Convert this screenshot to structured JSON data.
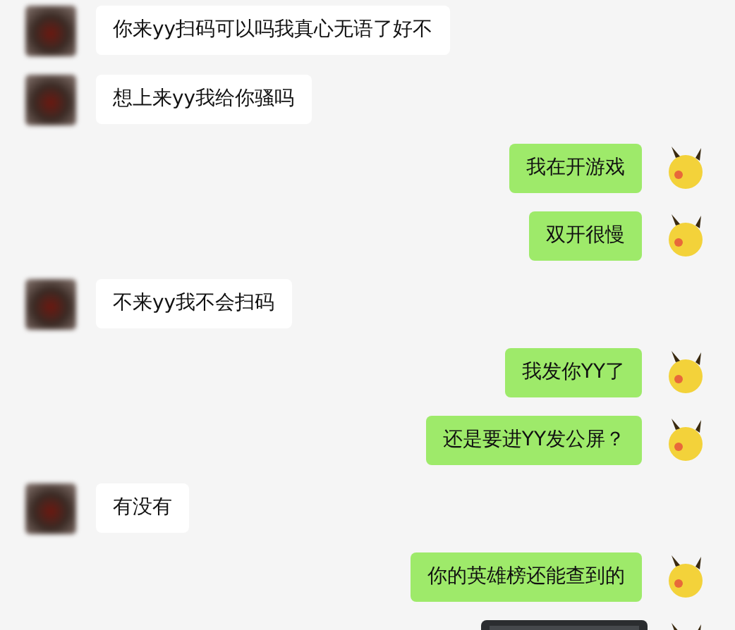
{
  "messages": [
    {
      "kind": "received",
      "text": "你来yy扫码可以吗我真心无语了好不"
    },
    {
      "kind": "received",
      "text": "想上来yy我给你骚吗"
    },
    {
      "kind": "sent",
      "text": "我在开游戏"
    },
    {
      "kind": "sent",
      "text": "双开很慢"
    },
    {
      "kind": "received",
      "text": "不来yy我不会扫码"
    },
    {
      "kind": "sent",
      "text": "我发你YY了"
    },
    {
      "kind": "sent",
      "text": "还是要进YY发公屏？"
    },
    {
      "kind": "received",
      "text": "有没有"
    },
    {
      "kind": "sent",
      "text": "你的英雄榜还能查到的"
    },
    {
      "kind": "sent_picture"
    }
  ]
}
